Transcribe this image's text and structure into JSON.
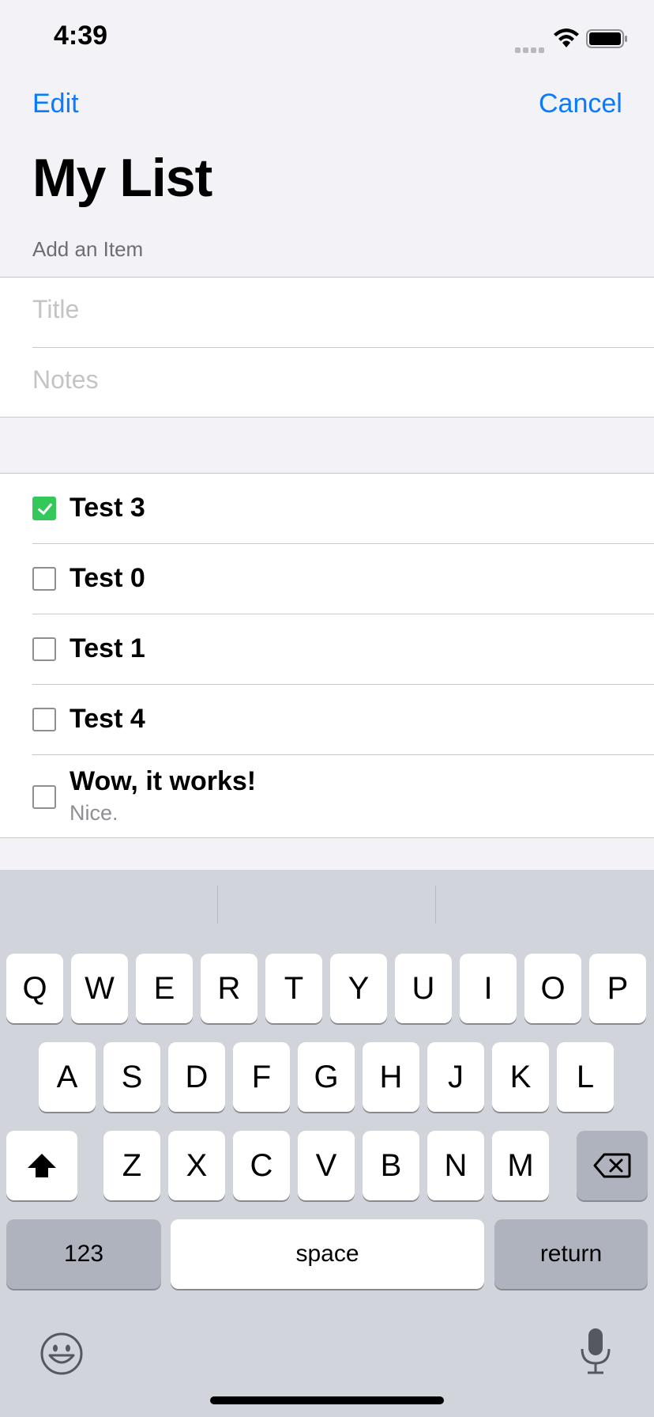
{
  "status_bar": {
    "time": "4:39"
  },
  "nav": {
    "edit_label": "Edit",
    "cancel_label": "Cancel",
    "title": "My List"
  },
  "add_section": {
    "header": "Add an Item",
    "title_placeholder": "Title",
    "notes_placeholder": "Notes"
  },
  "items": [
    {
      "title": "Test 3",
      "checked": true,
      "notes": ""
    },
    {
      "title": "Test 0",
      "checked": false,
      "notes": ""
    },
    {
      "title": "Test 1",
      "checked": false,
      "notes": ""
    },
    {
      "title": "Test 4",
      "checked": false,
      "notes": ""
    },
    {
      "title": "Wow, it works!",
      "checked": false,
      "notes": "Nice."
    }
  ],
  "keyboard": {
    "row1": [
      "Q",
      "W",
      "E",
      "R",
      "T",
      "Y",
      "U",
      "I",
      "O",
      "P"
    ],
    "row2": [
      "A",
      "S",
      "D",
      "F",
      "G",
      "H",
      "J",
      "K",
      "L"
    ],
    "row3": [
      "Z",
      "X",
      "C",
      "V",
      "B",
      "N",
      "M"
    ],
    "numbers_label": "123",
    "space_label": "space",
    "return_label": "return"
  },
  "colors": {
    "accent": "#0a7aff",
    "check_green": "#34c759",
    "keyboard_bg": "#d1d4da"
  },
  "icons": [
    "wifi-icon",
    "battery-icon",
    "shift-icon",
    "delete-icon",
    "emoji-icon",
    "microphone-icon"
  ]
}
